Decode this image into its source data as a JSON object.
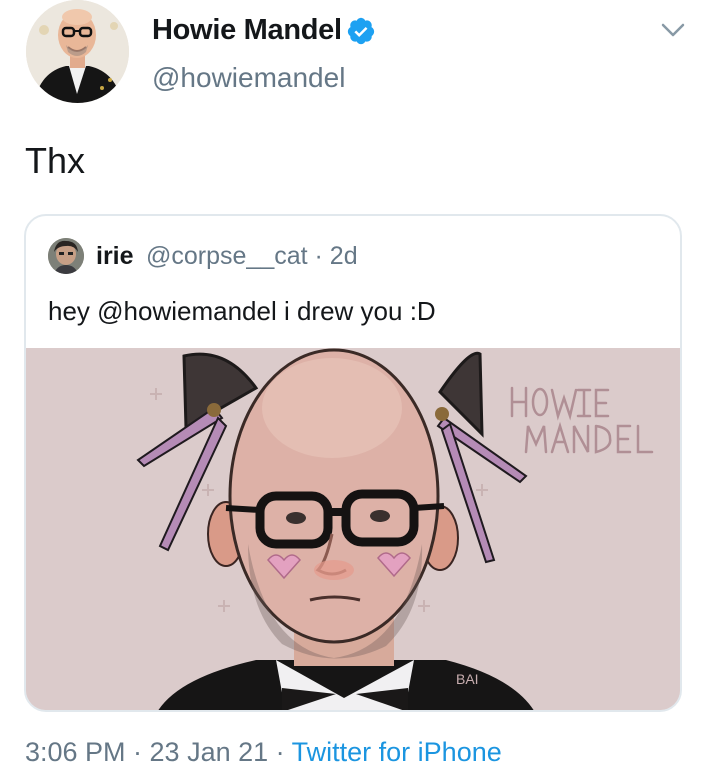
{
  "author": {
    "display_name": "Howie Mandel",
    "handle": "@howiemandel",
    "verified_icon": "verified-badge-icon",
    "menu_icon": "chevron-down-icon"
  },
  "tweet": {
    "text": "Thx"
  },
  "quoted_tweet": {
    "name": "irie",
    "meta": "@corpse__cat · 2d",
    "text": "hey @howiemandel i drew you :D",
    "artwork": {
      "lettering": "HOWIE MANDEL",
      "signature": "BAI"
    }
  },
  "footer": {
    "time": "3:06 PM · 23 Jan 21 · ",
    "source": "Twitter for iPhone"
  },
  "colors": {
    "accent": "#1da1f2",
    "link": "#1b95e0",
    "secondary_text": "#657786",
    "artwork_background": "#dbcbcb"
  }
}
